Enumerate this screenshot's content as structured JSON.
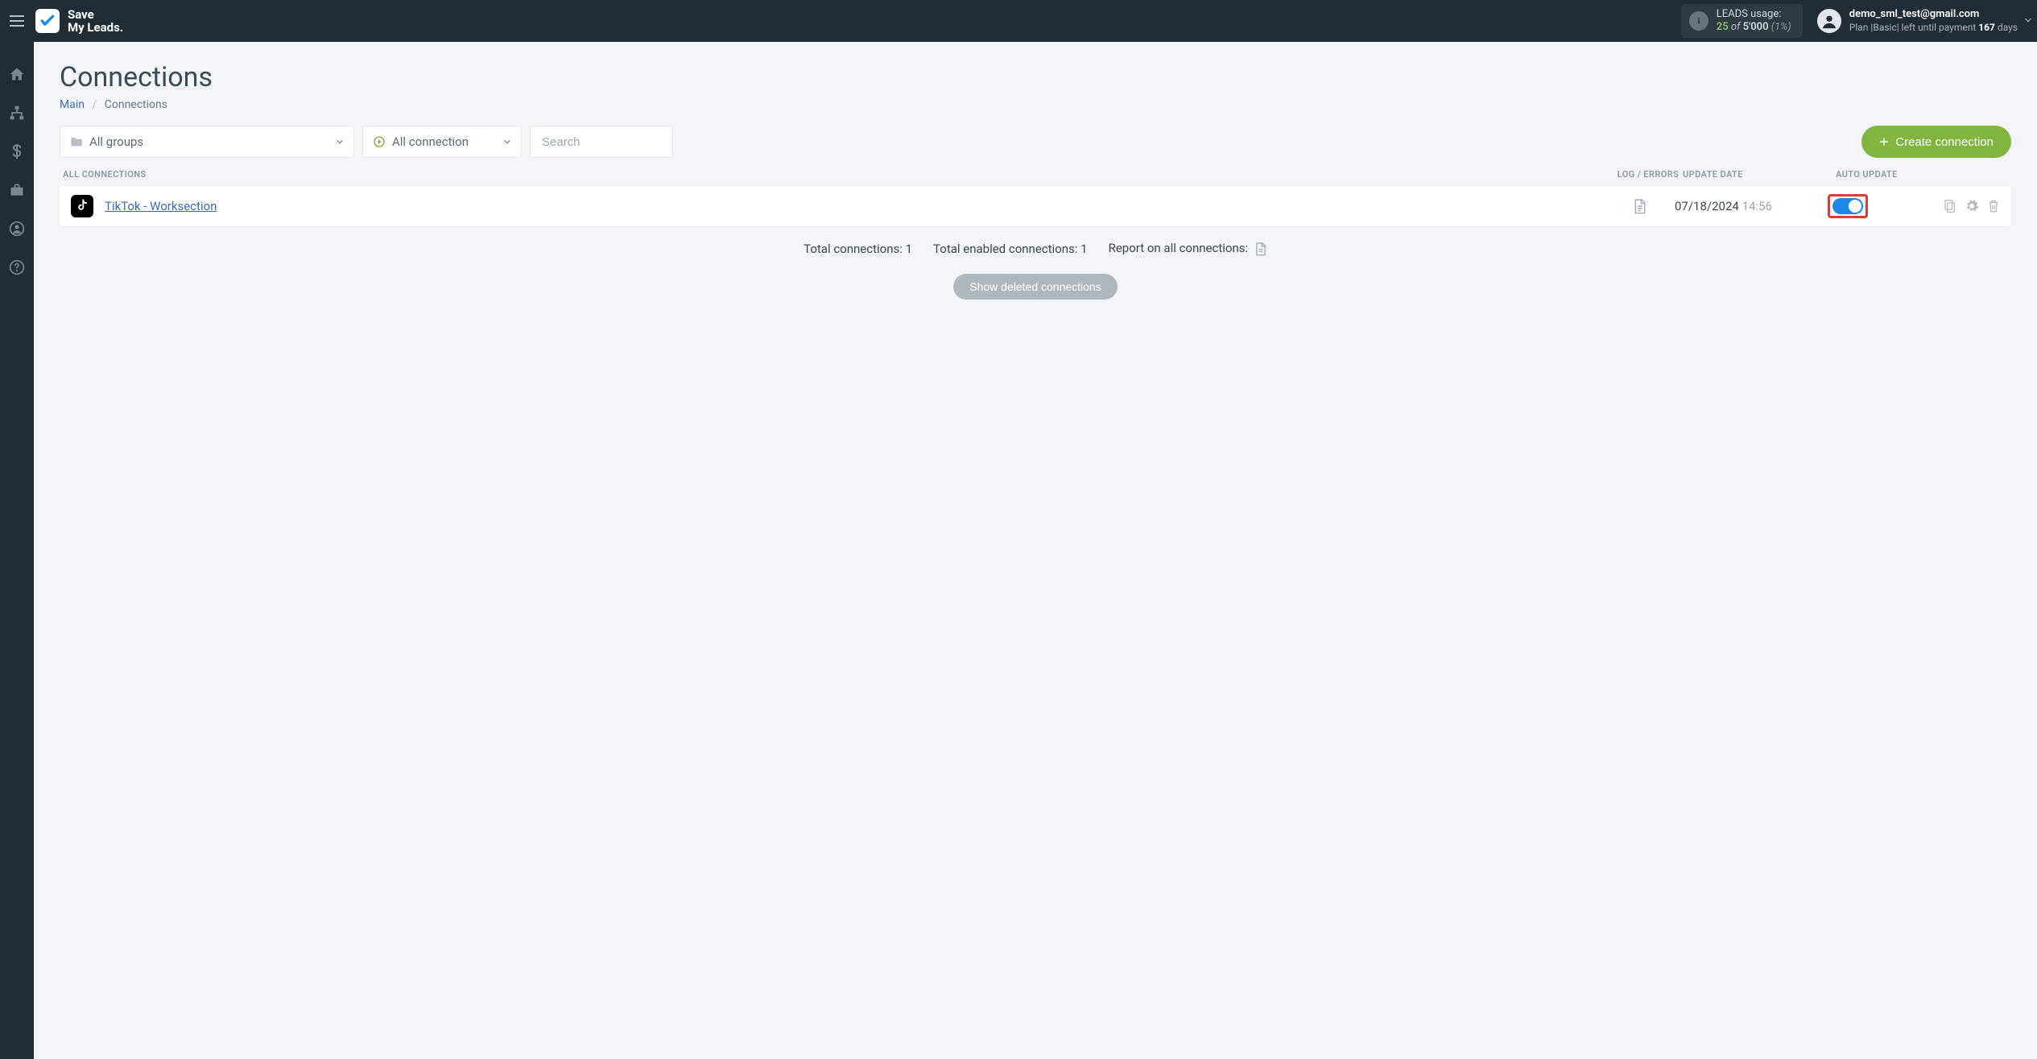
{
  "header": {
    "logo_line1": "Save",
    "logo_line2": "My Leads.",
    "usage": {
      "label": "LEADS usage:",
      "used": "25",
      "of": "of",
      "total": "5'000",
      "pct": "(1%)"
    },
    "user": {
      "email": "demo_sml_test@gmail.com",
      "plan_prefix": "Plan |",
      "plan_name": "Basic",
      "plan_mid": "| left until payment",
      "days": "167",
      "days_unit": "days"
    }
  },
  "page": {
    "title": "Connections",
    "breadcrumb": {
      "main": "Main",
      "current": "Connections"
    }
  },
  "toolbar": {
    "groups": "All groups",
    "connection_filter": "All connection",
    "search_placeholder": "Search",
    "create_button": "Create connection"
  },
  "columns": {
    "name": "ALL CONNECTIONS",
    "log": "LOG / ERRORS",
    "date": "UPDATE DATE",
    "auto": "AUTO UPDATE"
  },
  "rows": [
    {
      "name": "TikTok - Worksection",
      "date": "07/18/2024",
      "time": "14:56",
      "auto_update": true
    }
  ],
  "stats": {
    "total_label": "Total connections:",
    "total_val": "1",
    "enabled_label": "Total enabled connections:",
    "enabled_val": "1",
    "report_label": "Report on all connections:"
  },
  "footer": {
    "show_deleted": "Show deleted connections"
  }
}
